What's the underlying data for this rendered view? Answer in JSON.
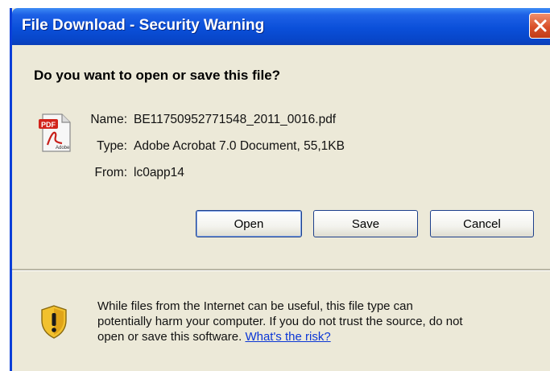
{
  "window": {
    "title": "File Download - Security Warning"
  },
  "dialog": {
    "question": "Do you want to open or save this file?",
    "file_icon": "pdf-document-icon",
    "fields": [
      {
        "label": "Name:",
        "value": "BE11750952771548_2011_0016.pdf"
      },
      {
        "label": "Type:",
        "value": "Adobe Acrobat 7.0 Document, 55,1KB"
      },
      {
        "label": "From:",
        "value": "lc0app14"
      }
    ],
    "buttons": {
      "open": "Open",
      "save": "Save",
      "cancel": "Cancel"
    }
  },
  "warning": {
    "icon": "security-shield-warning-icon",
    "line1": "While files from the Internet can be useful, this file type can",
    "line2": "potentially harm your computer. If you do not trust the source, do not",
    "line3": "open or save this software.",
    "link": "What's the risk?"
  },
  "colors": {
    "titlebar": "#0a4fd9",
    "dialog_bg": "#ece9d8",
    "close_button": "#d9502a",
    "link": "#0b36d6"
  }
}
